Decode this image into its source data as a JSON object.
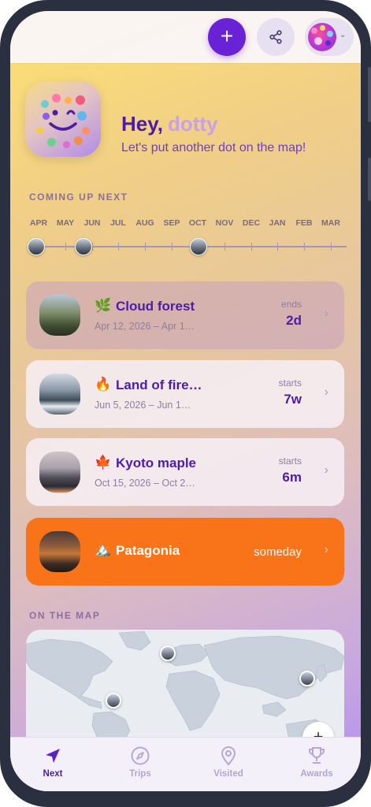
{
  "header": {
    "add_icon": "plus-icon",
    "add_label": "+",
    "share_icon": "share-icon",
    "profile_chevron": "⌄"
  },
  "hero": {
    "greeting": "Hey,",
    "username": "dotty",
    "subtitle": "Let's put another dot on the map!"
  },
  "coming_up": {
    "heading": "COMING UP NEXT",
    "months": [
      "APR",
      "MAY",
      "JUN",
      "JUL",
      "AUG",
      "SEP",
      "OCT",
      "NOV",
      "DEC",
      "JAN",
      "FEB",
      "MAR"
    ]
  },
  "trips": [
    {
      "emoji": "🌿",
      "title": "Cloud forest",
      "dates": "Apr 12, 2026 – Apr 1…",
      "label": "ends",
      "value": "2d"
    },
    {
      "emoji": "🔥",
      "title": "Land of fire…",
      "dates": "Jun 5, 2026 – Jun 1…",
      "label": "starts",
      "value": "7w"
    },
    {
      "emoji": "🍁",
      "title": "Kyoto maple",
      "dates": "Oct 15, 2026 – Oct 2…",
      "label": "starts",
      "value": "6m"
    },
    {
      "emoji": "🏔️",
      "title": "Patagonia",
      "status": "someday"
    }
  ],
  "map": {
    "heading": "ON THE MAP",
    "add_label": "+"
  },
  "tabs": [
    {
      "label": "Next",
      "icon": "navigation-arrow-icon",
      "active": true
    },
    {
      "label": "Trips",
      "icon": "compass-icon",
      "active": false
    },
    {
      "label": "Visited",
      "icon": "map-pin-icon",
      "active": false
    },
    {
      "label": "Awards",
      "icon": "trophy-icon",
      "active": false
    }
  ],
  "colors": {
    "accent": "#6a22d6",
    "primary_text": "#4d1ca8",
    "highlight_card": "#f97318",
    "username": "#c9a1e8"
  },
  "arrow": "›"
}
